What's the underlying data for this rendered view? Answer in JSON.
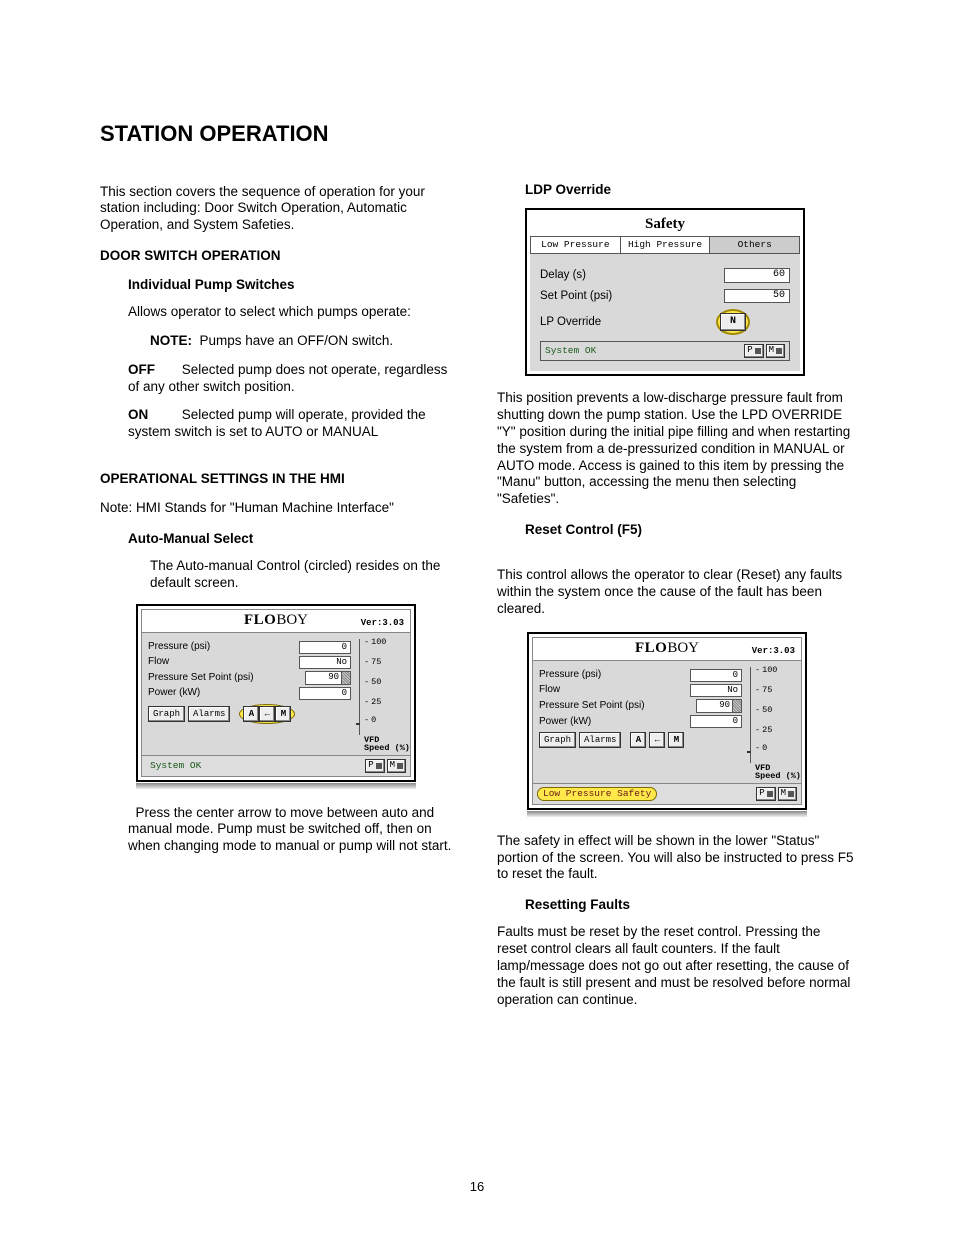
{
  "title": "STATION OPERATION",
  "pageNumber": "16",
  "left": {
    "intro": "This section covers the sequence of operation for your station including: Door Switch Operation, Automatic Operation, and System Safeties.",
    "sec1": {
      "heading": "DOOR SWITCH OPERATION",
      "sub1": "Individual Pump Switches",
      "p1": "Allows operator to select which pumps operate:",
      "noteLabel": "NOTE:",
      "noteText": "Pumps have an OFF/ON switch.",
      "offLabel": "OFF",
      "offText": "Selected pump does not operate, regardless of any other switch position.",
      "onLabel": "ON",
      "onText": "Selected pump will operate, provided the system switch is set to AUTO or MANUAL"
    },
    "sec2": {
      "heading": "OPERATIONAL SETTINGS IN THE HMI",
      "note": "Note: HMI Stands for \"Human Machine Interface\"",
      "sub1": "Auto-Manual Select",
      "p1": "The Auto-manual Control (circled) resides on the default screen.",
      "after": "  Press the center arrow to move between auto and manual mode. Pump must be switched off, then on when changing mode to manual or pump will not start."
    }
  },
  "right": {
    "ldp": {
      "heading": "LDP Override",
      "after": "This position prevents a low-discharge pressure fault from shutting down the pump station. Use the LPD OVERRIDE \"Y\" position during the initial pipe filling and when restarting the system from a de-pressurized condition in MANUAL or AUTO mode.  Access is gained to this item by pressing the \"Manu\" button, accessing the menu then selecting \"Safeties\"."
    },
    "reset": {
      "heading": "Reset Control (F5)",
      "p1": "This control allows the operator to clear (Reset) any faults within the system once the cause of the fault has been cleared.",
      "after": "The safety in effect will be shown in the lower \"Status\" portion of the screen.  You will also be instructed to press F5 to reset the fault."
    },
    "faults": {
      "heading": "Resetting Faults",
      "p1": "Faults must be reset by the reset control. Pressing the reset control clears all fault counters. If the fault lamp/message does not go out after resetting, the cause of the fault is still present and must be resolved before normal operation can continue."
    }
  },
  "hmi": {
    "brand1": "FLO",
    "brand2": "BOY",
    "version": "Ver:3.03",
    "rows": {
      "pressure": {
        "label": "Pressure (psi)",
        "value": "0"
      },
      "flow": {
        "label": "Flow",
        "value": "No"
      },
      "setpoint": {
        "label": "Pressure Set Point (psi)",
        "value": "90"
      },
      "power": {
        "label": "Power (kW)",
        "value": "0"
      }
    },
    "buttons": {
      "graph": "Graph",
      "alarms": "Alarms",
      "a": "A",
      "arrow": "←",
      "m": "M"
    },
    "gauge": {
      "ticks": [
        "100",
        "75",
        "50",
        "25",
        "0"
      ],
      "label": "VFD\nSpeed (%)"
    },
    "statusOk": "System OK",
    "statusAlert": "Low Pressure Safety",
    "pm": {
      "p": "P",
      "m": "M"
    }
  },
  "safety": {
    "title": "Safety",
    "tabs": [
      "Low Pressure",
      "High Pressure",
      "Others"
    ],
    "rows": {
      "delay": {
        "label": "Delay (s)",
        "value": "60"
      },
      "sp": {
        "label": "Set Point (psi)",
        "value": "50"
      },
      "lpo": {
        "label": "LP Override",
        "value": "N"
      }
    },
    "status": "System OK"
  }
}
